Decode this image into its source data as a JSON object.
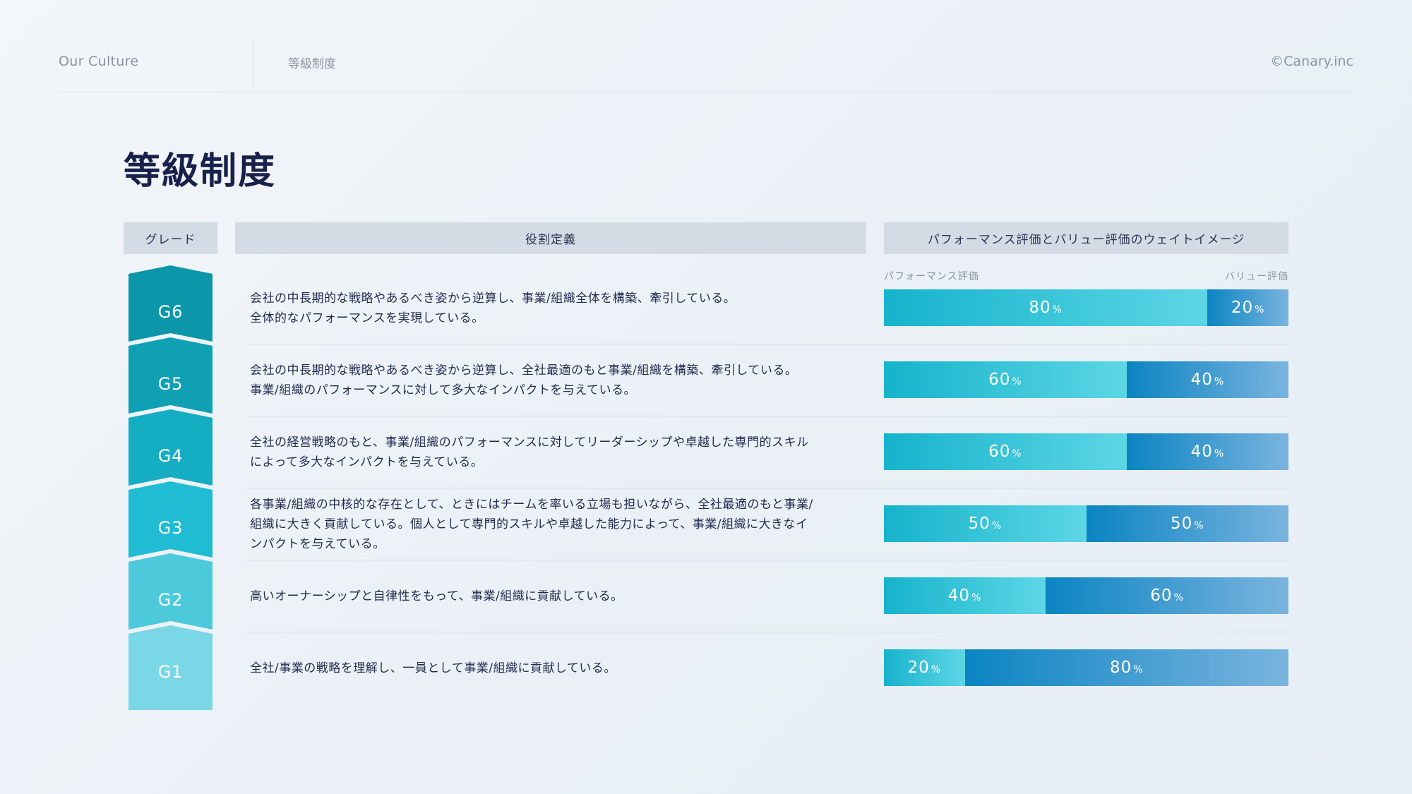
{
  "header": {
    "section": "Our Culture",
    "subsection": "等級制度",
    "copyright": "©Canary.inc"
  },
  "page_title": "等級制度",
  "columns": {
    "grade": "グレード",
    "role": "役割定義",
    "weight": "パフォーマンス評価とバリュー評価のウェイトイメージ"
  },
  "weight_labels": {
    "performance": "パフォーマンス評価",
    "value": "バリュー評価"
  },
  "percent_unit": "%",
  "colors": {
    "performance_start": "#16b3cc",
    "value_start": "#0b84c2",
    "header_bg": "#d3dbe5"
  },
  "grades": [
    {
      "label": "G6",
      "color": "#0c96a9",
      "description": "会社の中長期的な戦略やあるべき姿から逆算し、事業/組織全体を構築、牽引している。\n全体的なパフォーマンスを実現している。",
      "performance": 80,
      "value": 20,
      "performance_label": "80",
      "value_label": "20"
    },
    {
      "label": "G5",
      "color": "#0fa1b3",
      "description": "会社の中長期的な戦略やあるべき姿から逆算し、全社最適のもと事業/組織を構築、牽引している。\n事業/組織のパフォーマンスに対して多大なインパクトを与えている。",
      "performance": 60,
      "value": 40,
      "performance_label": "60",
      "value_label": "40"
    },
    {
      "label": "G4",
      "color": "#14adc2",
      "description": "全社の経営戦略のもと、事業/組織のパフォーマンスに対してリーダーシップや卓越した専門的スキル\nによって多大なインパクトを与えている。",
      "performance": 60,
      "value": 40,
      "performance_label": "60",
      "value_label": "40"
    },
    {
      "label": "G3",
      "color": "#1fbcd3",
      "description": "各事業/組織の中核的な存在として、ときにはチームを率いる立場も担いながら、全社最適のもと事業/\n組織に大きく貢献している。個人として専門的スキルや卓越した能力によって、事業/組織に大きなイ\nンパクトを与えている。",
      "performance": 50,
      "value": 50,
      "performance_label": "50",
      "value_label": "50"
    },
    {
      "label": "G2",
      "color": "#4ccadc",
      "description": "高いオーナーシップと自律性をもって、事業/組織に貢献している。",
      "performance": 40,
      "value": 60,
      "performance_label": "40",
      "value_label": "60"
    },
    {
      "label": "G1",
      "color": "#79d7e6",
      "description": "全社/事業の戦略を理解し、一員として事業/組織に貢献している。",
      "performance": 20,
      "value": 80,
      "performance_label": "20",
      "value_label": "80"
    }
  ]
}
